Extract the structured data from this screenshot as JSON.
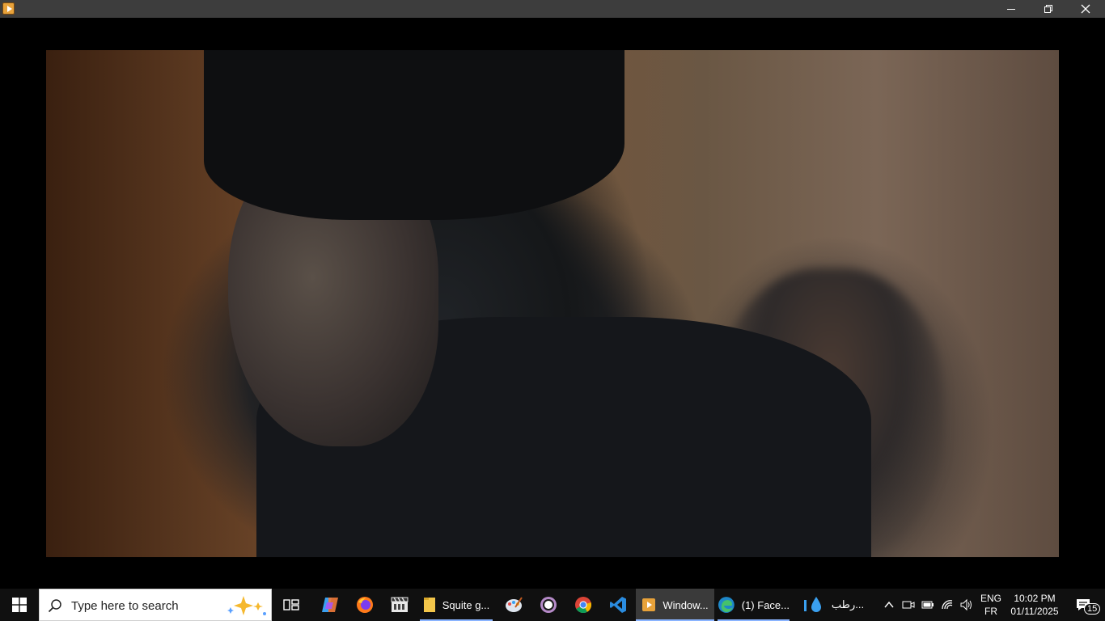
{
  "window": {
    "app_icon": "media-player-icon",
    "controls": {
      "minimize": "minimize-icon",
      "maximize": "restore-icon",
      "close": "close-icon"
    }
  },
  "video": {
    "description_icon": "video-frame"
  },
  "taskbar": {
    "start_icon": "windows-start-icon",
    "search": {
      "placeholder": "Type here to search",
      "icon": "search-icon"
    },
    "apps": [
      {
        "id": "task-view",
        "icon": "task-view-icon"
      },
      {
        "id": "copilot",
        "icon": "copilot-icon"
      },
      {
        "id": "firefox",
        "icon": "firefox-icon"
      },
      {
        "id": "clapper",
        "icon": "video-editor-icon"
      },
      {
        "id": "explorer",
        "icon": "folder-icon",
        "label": "Squite g..."
      },
      {
        "id": "paint",
        "icon": "paint-icon"
      },
      {
        "id": "obs",
        "icon": "circle-app-icon"
      },
      {
        "id": "chrome",
        "icon": "chrome-icon"
      },
      {
        "id": "vscode",
        "icon": "vscode-icon"
      },
      {
        "id": "player",
        "icon": "media-player-icon",
        "label": "Window..."
      },
      {
        "id": "edge",
        "icon": "edge-icon",
        "label": "(1) Face..."
      },
      {
        "id": "rtab",
        "icon": "droplet-icon",
        "label": "رطب..."
      }
    ],
    "tray": {
      "language_line1": "ENG",
      "language_line2": "FR",
      "time": "10:02 PM",
      "date": "01/11/2025",
      "notifications_count": "15"
    }
  },
  "colors": {
    "titlebar": "#3d3d3d",
    "taskbar": "#101010",
    "active_underline": "#8ab4ff"
  }
}
